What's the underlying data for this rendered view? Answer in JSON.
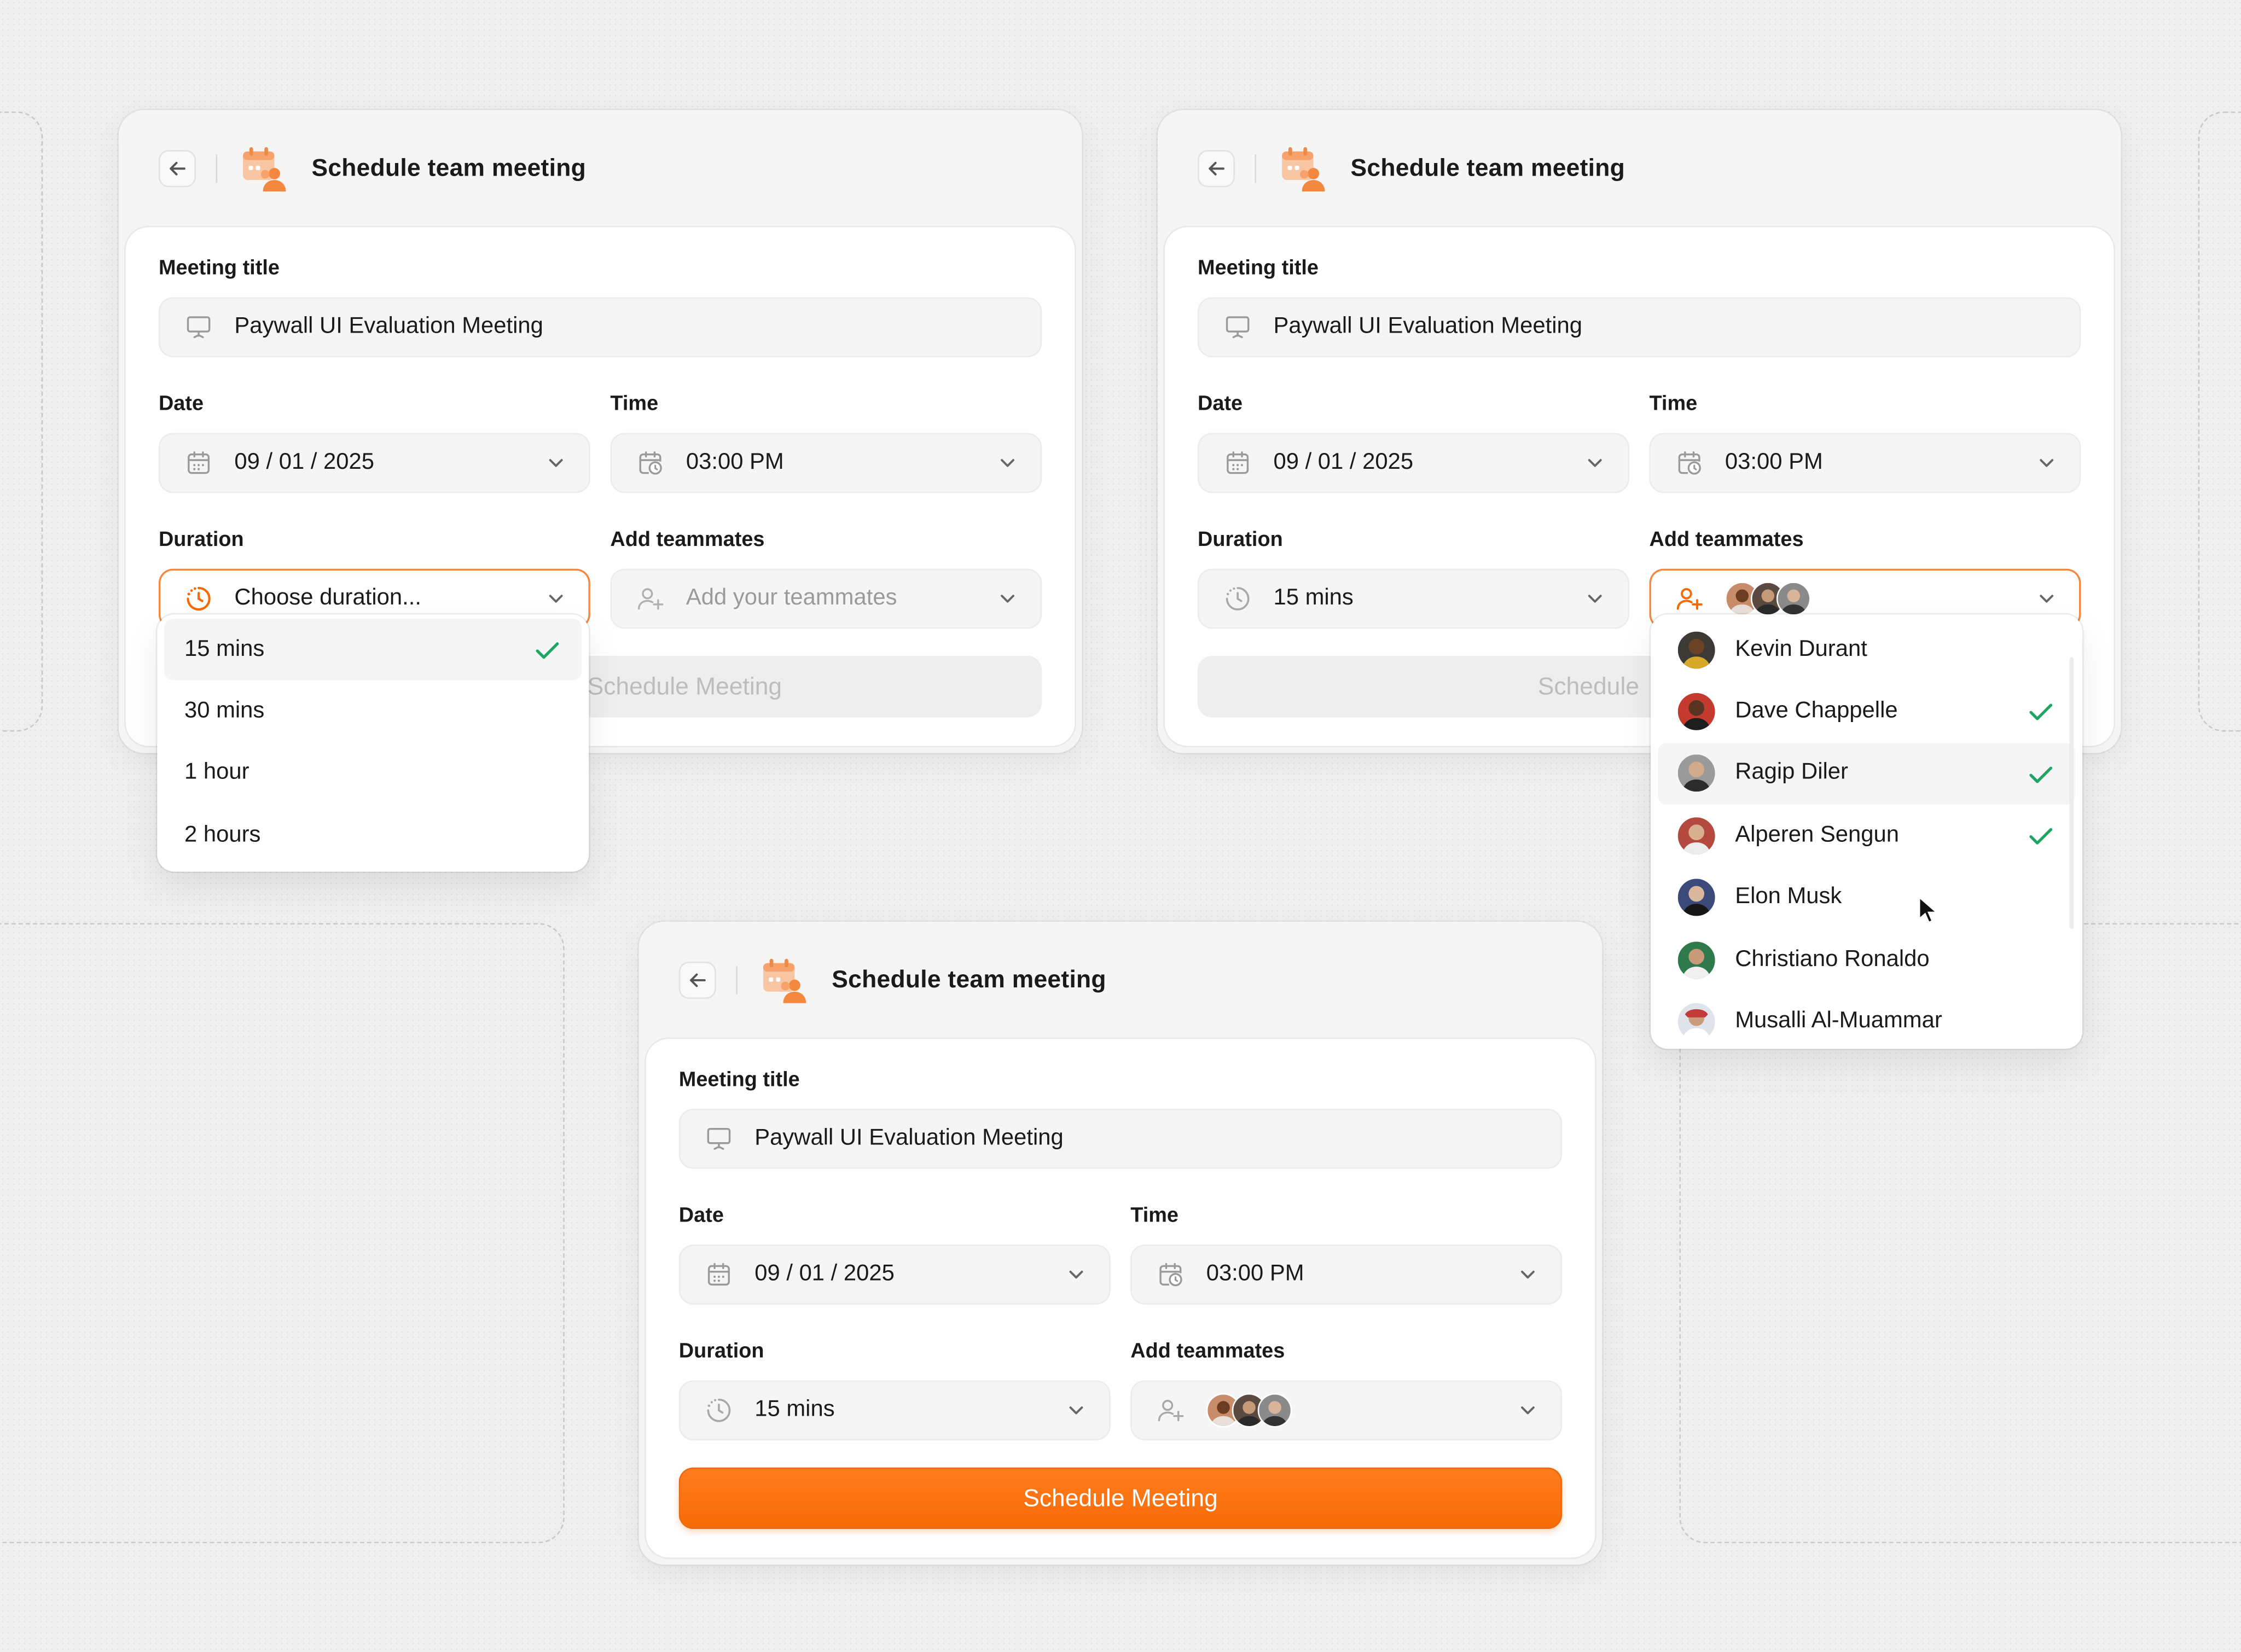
{
  "colors": {
    "accent": "#f76a06",
    "check": "#1fa463",
    "border_active": "#f5883e"
  },
  "cards": [
    {
      "title": "Schedule team meeting",
      "meeting_title_label": "Meeting title",
      "meeting_title_value": "Paywall UI Evaluation Meeting",
      "date_label": "Date",
      "date_value": "09 / 01 / 2025",
      "time_label": "Time",
      "time_value": "03:00 PM",
      "duration_label": "Duration",
      "duration_placeholder": "Choose duration...",
      "teammates_label": "Add teammates",
      "teammates_placeholder": "Add your teammates",
      "button_label": "Schedule Meeting",
      "duration_options": [
        {
          "label": "15 mins",
          "selected": true
        },
        {
          "label": "30 mins",
          "selected": false
        },
        {
          "label": "1 hour",
          "selected": false
        },
        {
          "label": "2 hours",
          "selected": false
        }
      ]
    },
    {
      "title": "Schedule team meeting",
      "meeting_title_label": "Meeting title",
      "meeting_title_value": "Paywall UI Evaluation Meeting",
      "date_label": "Date",
      "date_value": "09 / 01 / 2025",
      "time_label": "Time",
      "time_value": "03:00 PM",
      "duration_label": "Duration",
      "duration_value": "15 mins",
      "teammates_label": "Add teammates",
      "button_label": "Schedule",
      "teammates": [
        {
          "name": "Kevin Durant",
          "selected": false
        },
        {
          "name": "Dave Chappelle",
          "selected": true
        },
        {
          "name": "Ragip Diler",
          "selected": true
        },
        {
          "name": "Alperen Sengun",
          "selected": true
        },
        {
          "name": "Elon Musk",
          "selected": false
        },
        {
          "name": "Christiano Ronaldo",
          "selected": false
        },
        {
          "name": "Musalli Al-Muammar",
          "selected": false
        }
      ]
    },
    {
      "title": "Schedule team meeting",
      "meeting_title_label": "Meeting title",
      "meeting_title_value": "Paywall UI Evaluation Meeting",
      "date_label": "Date",
      "date_value": "09 / 01 / 2025",
      "time_label": "Time",
      "time_value": "03:00 PM",
      "duration_label": "Duration",
      "duration_value": "15 mins",
      "teammates_label": "Add teammates",
      "button_label": "Schedule Meeting"
    }
  ]
}
